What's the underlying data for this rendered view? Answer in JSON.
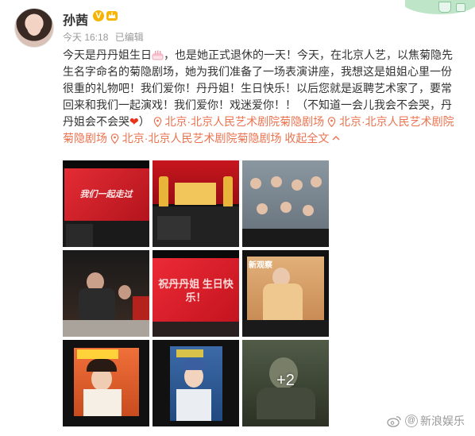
{
  "user": {
    "name": "孙茜",
    "verified_icon": "verified-v-icon",
    "badge_icon": "crown-icon"
  },
  "meta": {
    "time": "今天 16:18",
    "edited": "已编辑"
  },
  "post": {
    "text_1": "今天是丹丹姐生日",
    "cake_icon": "birthday-cake-icon",
    "text_2": "，也是她正式退休的一天！今天，在北京人艺，以焦菊隐先生名字命名的菊隐剧场，她为我们准备了一场表演讲座，我想这是姐姐心里一份很重的礼物吧！我们爱你！丹丹姐！生日快乐！以后您就是返聘艺术家了，要常回来和我们一起演戏！我们爱你！戏迷爱你！！（不知道一会儿我会不会哭，丹丹姐会不会哭",
    "heart_icon": "red-heart-icon",
    "heart_char": "❤",
    "text_3": "）",
    "locations": [
      "北京·北京人民艺术剧院菊隐剧场",
      "北京·北京人民艺术剧院菊隐剧场",
      "北京·北京人民艺术剧院菊隐剧场"
    ],
    "collapse_label": "收起全文",
    "collapse_icon": "chevron-up-icon"
  },
  "images": [
    {
      "caption": "我们一起走过",
      "accent": "#d8262f"
    },
    {
      "caption": "",
      "accent": "#b0121a"
    },
    {
      "caption": "",
      "accent": "#6a7a8a"
    },
    {
      "caption": "",
      "accent": "#3a2a22"
    },
    {
      "caption": "祝丹丹姐 生日快乐！",
      "accent": "#e01f2b"
    },
    {
      "caption": "新观察",
      "accent": "#d9a067"
    },
    {
      "caption": "",
      "accent": "#e65a2a"
    },
    {
      "caption": "",
      "accent": "#2a4f8a"
    },
    {
      "caption": "",
      "accent": "#5a6a50"
    }
  ],
  "more_photos": "+2",
  "watermark": {
    "icon": "weibo-logo-icon",
    "at": "@",
    "text": "新浪娱乐"
  },
  "colors": {
    "link": "#eb7350",
    "meta": "#999999",
    "heart": "#e8331a",
    "verified": "#f6b400"
  }
}
